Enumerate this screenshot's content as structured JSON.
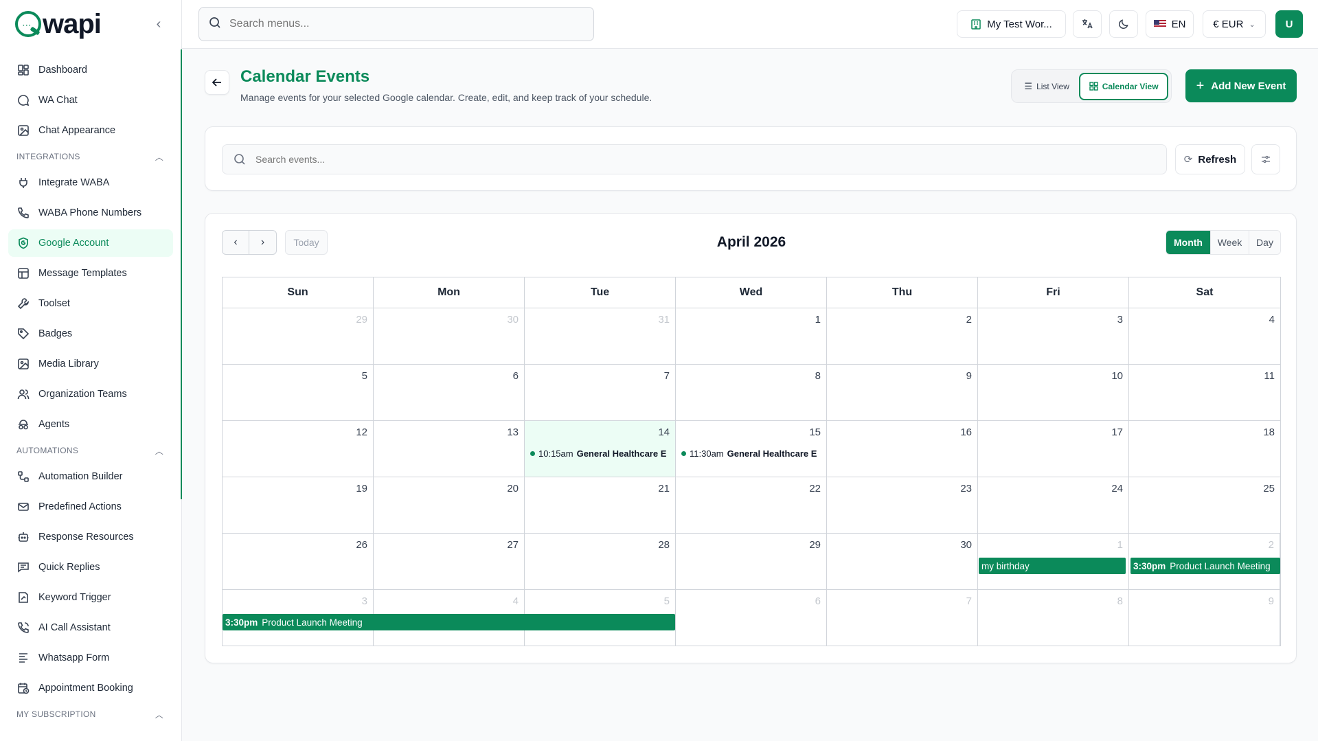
{
  "brand": {
    "name": "wapi",
    "dots": "···"
  },
  "sidebar": {
    "items_top": [
      {
        "label": "Dashboard",
        "icon": "dashboard-icon"
      },
      {
        "label": "WA Chat",
        "icon": "chat-icon"
      },
      {
        "label": "Chat Appearance",
        "icon": "image-icon"
      }
    ],
    "section_integrations": "INTEGRATIONS",
    "items_integrations": [
      {
        "label": "Integrate WABA",
        "icon": "plug-icon"
      },
      {
        "label": "WABA Phone Numbers",
        "icon": "phone-icon"
      },
      {
        "label": "Google Account",
        "icon": "google-shield-icon"
      },
      {
        "label": "Message Templates",
        "icon": "template-icon"
      },
      {
        "label": "Toolset",
        "icon": "wrench-icon"
      },
      {
        "label": "Badges",
        "icon": "tag-icon"
      },
      {
        "label": "Media Library",
        "icon": "media-icon"
      },
      {
        "label": "Organization Teams",
        "icon": "team-icon"
      },
      {
        "label": "Agents",
        "icon": "agent-icon"
      }
    ],
    "section_automations": "AUTOMATIONS",
    "items_automations": [
      {
        "label": "Automation Builder",
        "icon": "workflow-icon"
      },
      {
        "label": "Predefined Actions",
        "icon": "mail-icon"
      },
      {
        "label": "Response Resources",
        "icon": "bot-icon"
      },
      {
        "label": "Quick Replies",
        "icon": "reply-icon"
      },
      {
        "label": "Keyword Trigger",
        "icon": "keyword-icon"
      },
      {
        "label": "AI Call Assistant",
        "icon": "call-icon"
      },
      {
        "label": "Whatsapp Form",
        "icon": "form-icon"
      },
      {
        "label": "Appointment Booking",
        "icon": "booking-icon"
      }
    ],
    "section_subscription": "MY SUBSCRIPTION"
  },
  "topbar": {
    "search_placeholder": "Search menus...",
    "workspace": "My Test Wor...",
    "language": "EN",
    "currency": "€ EUR",
    "avatar": "U"
  },
  "header": {
    "title": "Calendar Events",
    "subtitle": "Manage events for your selected Google calendar. Create, edit, and keep track of your schedule.",
    "list_view": "List View",
    "calendar_view": "Calendar View",
    "add_event": "Add New Event"
  },
  "filters": {
    "search_placeholder": "Search events...",
    "refresh": "Refresh"
  },
  "calendar": {
    "title": "April 2026",
    "today": "Today",
    "views": [
      "Month",
      "Week",
      "Day"
    ],
    "active_view": "Month",
    "weekdays": [
      "Sun",
      "Mon",
      "Tue",
      "Wed",
      "Thu",
      "Fri",
      "Sat"
    ],
    "weeks": [
      [
        "29",
        "30",
        "31",
        "1",
        "2",
        "3",
        "4"
      ],
      [
        "5",
        "6",
        "7",
        "8",
        "9",
        "10",
        "11"
      ],
      [
        "12",
        "13",
        "14",
        "15",
        "16",
        "17",
        "18"
      ],
      [
        "19",
        "20",
        "21",
        "22",
        "23",
        "24",
        "25"
      ],
      [
        "26",
        "27",
        "28",
        "29",
        "30",
        "1",
        "2"
      ],
      [
        "3",
        "4",
        "5",
        "6",
        "7",
        "8",
        "9"
      ]
    ],
    "other_month_cells": [
      [
        0,
        0
      ],
      [
        0,
        1
      ],
      [
        0,
        2
      ],
      [
        4,
        5
      ],
      [
        4,
        6
      ],
      [
        5,
        0
      ],
      [
        5,
        1
      ],
      [
        5,
        2
      ],
      [
        5,
        3
      ],
      [
        5,
        4
      ],
      [
        5,
        5
      ],
      [
        5,
        6
      ]
    ],
    "today_cell": [
      2,
      2
    ],
    "events": {
      "ev1": {
        "time": "10:15am",
        "title": "General Healthcare E"
      },
      "ev2": {
        "time": "11:30am",
        "title": "General Healthcare E"
      },
      "ev3": {
        "time": "",
        "title": "my birthday"
      },
      "ev4": {
        "time": "3:30pm",
        "title": "Product Launch Meeting"
      },
      "ev5": {
        "time": "3:30pm",
        "title": "Product Launch Meeting"
      }
    }
  },
  "colors": {
    "accent": "#0b8a5a",
    "accent_light": "#ecfdf5"
  }
}
